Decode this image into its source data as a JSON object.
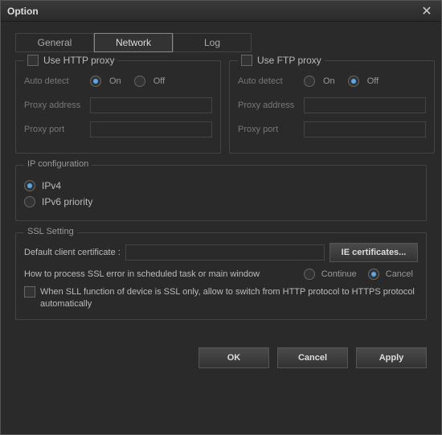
{
  "title": "Option",
  "tabs": {
    "general": "General",
    "network": "Network",
    "log": "Log",
    "active": "network"
  },
  "http_proxy": {
    "title": "Use HTTP proxy",
    "auto_detect": "Auto detect",
    "on": "On",
    "off": "Off",
    "selected": "on",
    "address_label": "Proxy address",
    "address": "",
    "port_label": "Proxy port",
    "port": ""
  },
  "ftp_proxy": {
    "title": "Use FTP proxy",
    "auto_detect": "Auto detect",
    "on": "On",
    "off": "Off",
    "selected": "off",
    "address_label": "Proxy address",
    "address": "",
    "port_label": "Proxy port",
    "port": ""
  },
  "ip": {
    "legend": "IP configuration",
    "ipv4": "IPv4",
    "ipv6": "IPv6 priority",
    "selected": "ipv4"
  },
  "ssl": {
    "legend": "SSL Setting",
    "cert_label": "Default client certificate :",
    "cert_value": "",
    "ie_btn": "IE certificates...",
    "error_label": "How to process SSL error in scheduled task or main window",
    "continue": "Continue",
    "cancel": "Cancel",
    "error_selected": "cancel",
    "auto_https": "When SLL function of device is SSL only, allow to switch from HTTP protocol  to HTTPS protocol automatically"
  },
  "buttons": {
    "ok": "OK",
    "cancel": "Cancel",
    "apply": "Apply"
  }
}
